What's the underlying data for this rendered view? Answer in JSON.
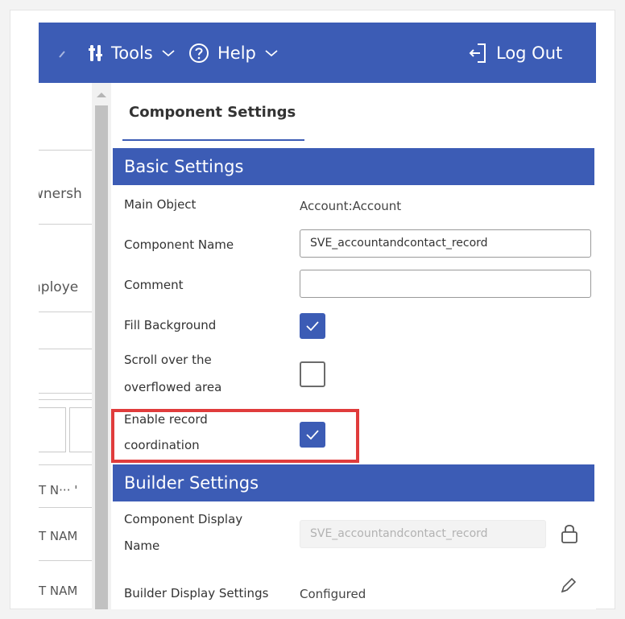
{
  "topbar": {
    "tools_label": "Tools",
    "help_label": "Help",
    "logout_label": "Log Out"
  },
  "left_panel": {
    "fragments": [
      "wnersh",
      "nploye",
      "T N··· '",
      "T NAM",
      "T NAM"
    ]
  },
  "panel": {
    "title": "Component Settings",
    "basic_section": {
      "header": "Basic Settings",
      "main_object_label": "Main Object",
      "main_object_value": "Account:Account",
      "component_name_label": "Component Name",
      "component_name_value": "SVE_accountandcontact_record",
      "comment_label": "Comment",
      "comment_value": "",
      "fill_background_label": "Fill Background",
      "fill_background_checked": true,
      "scroll_label_line1": "Scroll over the",
      "scroll_label_line2": "overflowed area",
      "scroll_checked": false,
      "record_coord_label_line1": "Enable record",
      "record_coord_label_line2": "coordination",
      "record_coord_checked": true
    },
    "builder_section": {
      "header": "Builder Settings",
      "display_name_label_line1": "Component Display",
      "display_name_label_line2": "Name",
      "display_name_value": "SVE_accountandcontact_record",
      "display_settings_label": "Builder Display Settings",
      "display_settings_value": "Configured"
    }
  },
  "colors": {
    "accent": "#3c5cb5",
    "highlight": "#e03c3c"
  },
  "icons": [
    "tools-icon",
    "help-icon",
    "logout-icon",
    "lock-icon",
    "pencil-icon",
    "checkmark-icon"
  ]
}
